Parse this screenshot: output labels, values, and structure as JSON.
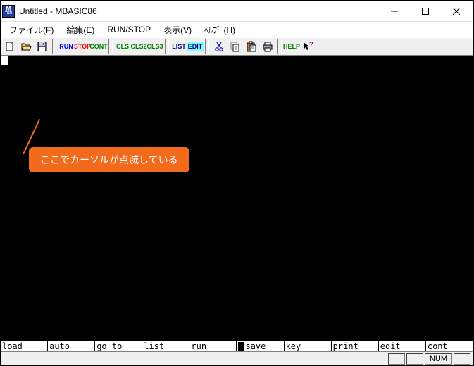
{
  "titlebar": {
    "title": "Untitled - MBASIC86",
    "icon_top": "M",
    "icon_bot": "TSR"
  },
  "menu": {
    "file": "ファイル(F)",
    "edit": "編集(E)",
    "runstop": "RUN/STOP",
    "view": "表示(V)",
    "help": "ﾍﾙﾌﾟ (H)"
  },
  "toolbar": {
    "run": "RUN",
    "stop": "STOP",
    "cont": "CONT",
    "cls": "CLS",
    "cls2": "CLS2",
    "cls3": "CLS3",
    "list": "LIST",
    "edit": "EDIT",
    "help": "HELP"
  },
  "callout": {
    "text": "ここでカーソルが点滅している"
  },
  "fkeys": [
    "load",
    "auto",
    "go to",
    "list",
    "run",
    "save",
    "key",
    "print",
    "edit",
    "cont"
  ],
  "status": {
    "num": "NUM"
  }
}
